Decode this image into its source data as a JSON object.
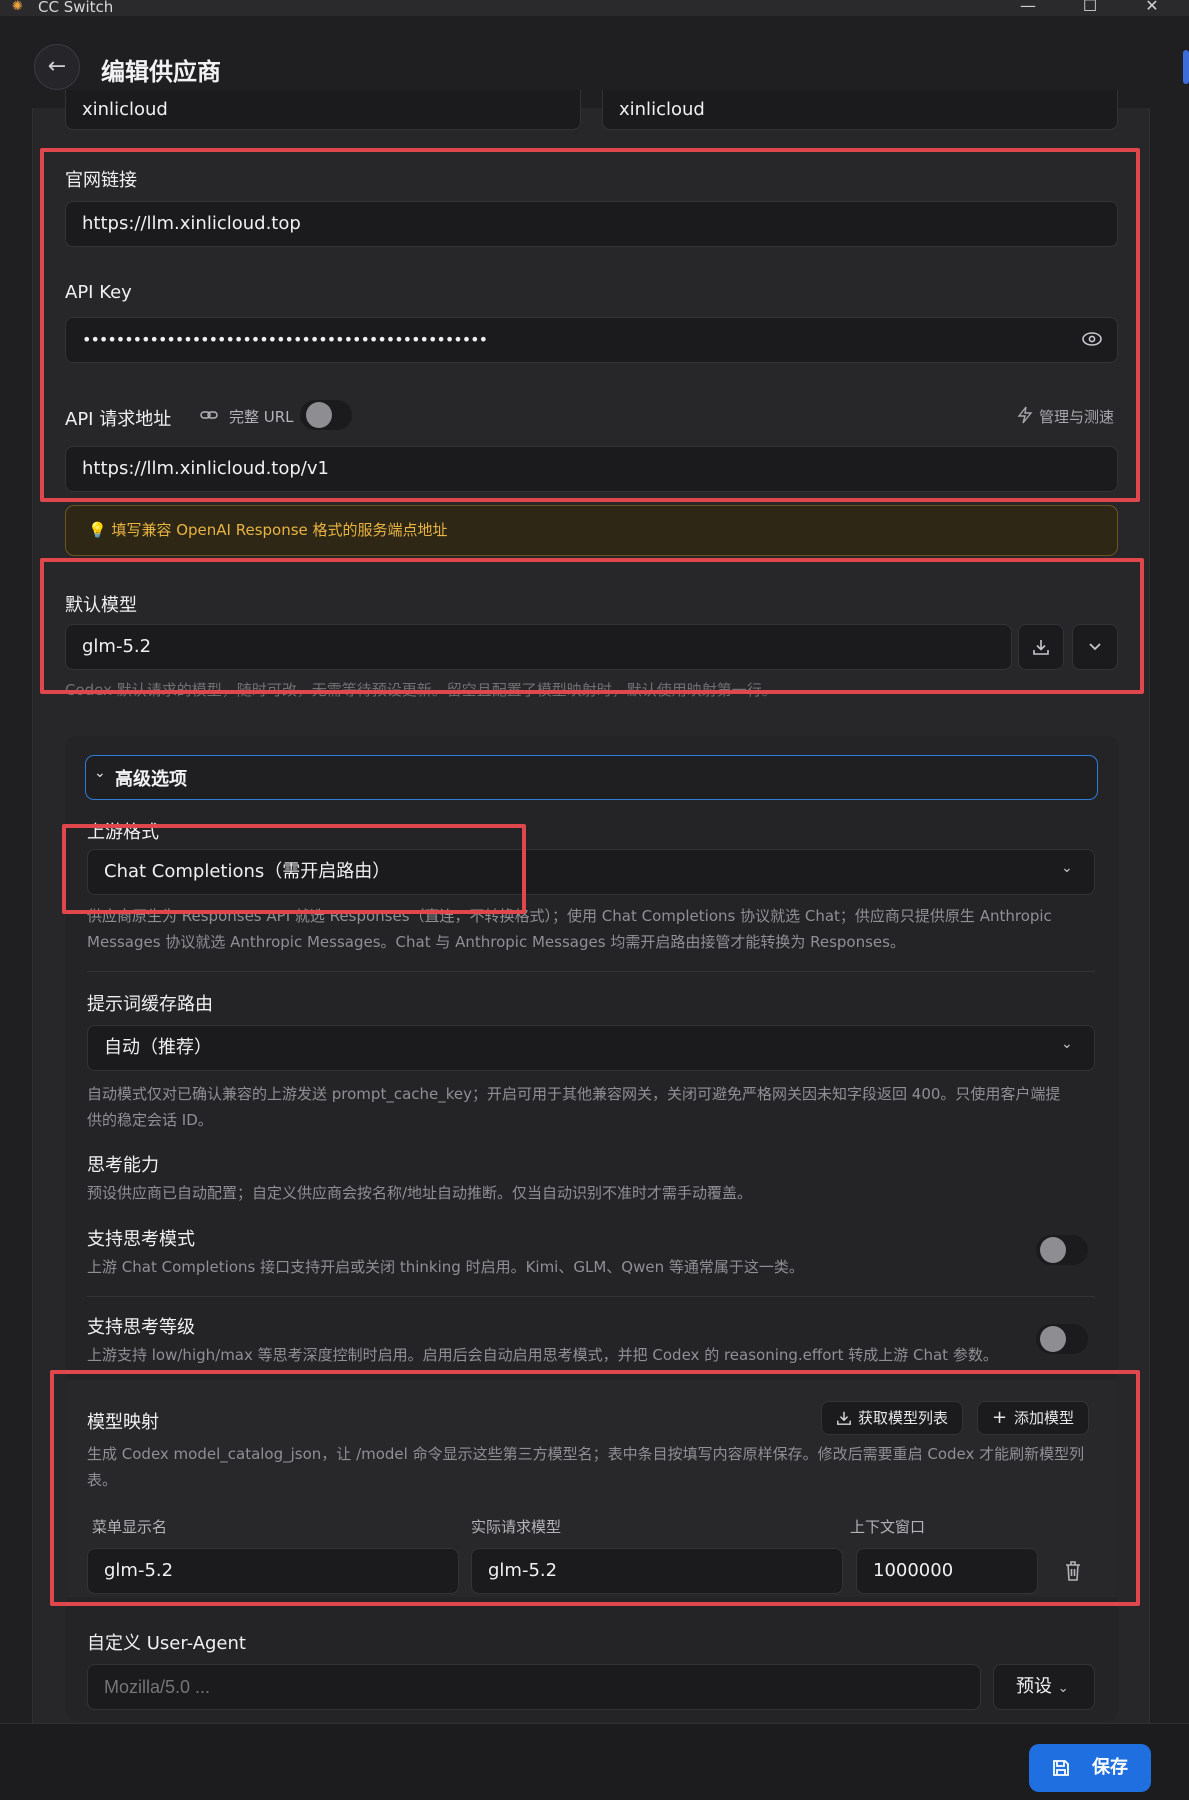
{
  "window": {
    "title": "CC Switch",
    "minimize": "—",
    "maximize": "☐",
    "close": "✕"
  },
  "header": {
    "back": "←",
    "title": "编辑供应商"
  },
  "top_fields": {
    "name_value": "xinlicloud",
    "note_value": "xinlicloud"
  },
  "website": {
    "label": "官网链接",
    "value": "https://llm.xinlicloud.top"
  },
  "api_key": {
    "label": "API Key",
    "value": "••••••••••••••••••••••••••••••••••••••••••••••••",
    "eye_icon": "eye-icon"
  },
  "endpoint": {
    "label": "API 请求地址",
    "full_url_label": "完整 URL",
    "full_url_enabled": false,
    "manage_label": "管理与测速",
    "value": "https://llm.xinlicloud.top/v1",
    "warning": "填写兼容 OpenAI Response 格式的服务端点地址"
  },
  "default_model": {
    "label": "默认模型",
    "value": "glm-5.2",
    "hint": "Codex 默认请求的模型，随时可改，无需等待预设更新。留空且配置了模型映射时，默认使用映射第一行。"
  },
  "advanced": {
    "toggle_label": "高级选项",
    "upstream_format": {
      "label": "上游格式",
      "value": "Chat Completions（需开启路由）",
      "hint_line1": "供应商原生为 Responses API 就选 Responses（直连，不转换格式）；使用 Chat Completions 协议就选 Chat；供应商只提供原生 Anthropic",
      "hint_line2": "Messages 协议就选 Anthropic Messages。Chat 与 Anthropic Messages 均需开启路由接管才能转换为 Responses。"
    },
    "prompt_cache": {
      "label": "提示词缓存路由",
      "value": "自动（推荐）",
      "hint_line1": "自动模式仅对已确认兼容的上游发送 prompt_cache_key；开启可用于其他兼容网关，关闭可避免严格网关因未知字段返回 400。只使用客户端提",
      "hint_line2": "供的稳定会话 ID。"
    },
    "thinking": {
      "label": "思考能力",
      "hint": "预设供应商已自动配置；自定义供应商会按名称/地址自动推断。仅当自动识别不准时才需手动覆盖。"
    },
    "thinking_mode": {
      "label": "支持思考模式",
      "hint": "上游 Chat Completions 接口支持开启或关闭 thinking 时启用。Kimi、GLM、Qwen 等通常属于这一类。",
      "enabled": false
    },
    "thinking_level": {
      "label": "支持思考等级",
      "hint": "上游支持 low/high/max 等思考深度控制时启用。启用后会自动启用思考模式，并把 Codex 的 reasoning.effort 转成上游 Chat 参数。",
      "enabled": false
    },
    "model_mapping": {
      "label": "模型映射",
      "fetch_button": "获取模型列表",
      "add_button": "添加模型",
      "hint_line1": "生成 Codex model_catalog_json，让 /model 命令显示这些第三方模型名；表中条目按填写内容原样保存。修改后需要重启 Codex 才能刷新模型列",
      "hint_line2": "表。",
      "columns": [
        "菜单显示名",
        "实际请求模型",
        "上下文窗口"
      ],
      "rows": [
        {
          "display_name": "glm-5.2",
          "request_model": "glm-5.2",
          "context_window": "1000000"
        }
      ]
    },
    "user_agent": {
      "label": "自定义 User-Agent",
      "placeholder": "Mozilla/5.0 ...",
      "preset_button": "预设"
    }
  },
  "footer": {
    "save_label": "保存"
  },
  "colors": {
    "accent": "#1f6fe0",
    "highlight": "#e0474c",
    "warning": "#e7b341"
  }
}
